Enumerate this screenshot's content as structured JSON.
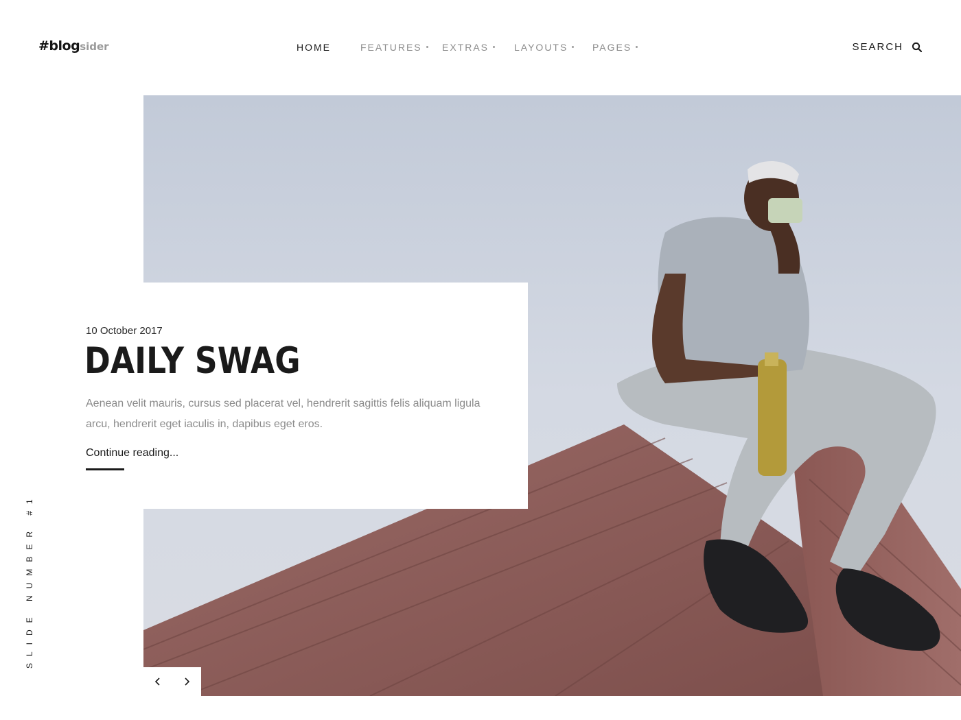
{
  "brand": {
    "logo_main": "#blog",
    "logo_sub": "sider"
  },
  "nav": {
    "items": [
      {
        "label": "HOME",
        "active": true,
        "has_dropdown": false
      },
      {
        "label": "FEATURES",
        "active": false,
        "has_dropdown": true
      },
      {
        "label": "EXTRAS",
        "active": false,
        "has_dropdown": true
      },
      {
        "label": "LAYOUTS",
        "active": false,
        "has_dropdown": true
      },
      {
        "label": "PAGES",
        "active": false,
        "has_dropdown": true
      }
    ]
  },
  "search": {
    "label": "SEARCH",
    "icon": "search-icon"
  },
  "slide": {
    "date": "10 October 2017",
    "title": "DAILY SWAG",
    "excerpt": "Aenean velit mauris, cursus sed placerat vel, hendrerit sagittis felis aliquam ligula arcu, hendrerit eget iaculis in, dapibus eget eros.",
    "read_more": "Continue reading...",
    "slide_number_label": "SLIDE NUMBER #1"
  },
  "controls": {
    "prev_icon": "chevron-left-icon",
    "next_icon": "chevron-right-icon"
  },
  "colors": {
    "text_dark": "#1a1a1a",
    "text_muted": "#8b8b8b",
    "sky": "#d3d9e4",
    "deck": "#8c5a55"
  }
}
